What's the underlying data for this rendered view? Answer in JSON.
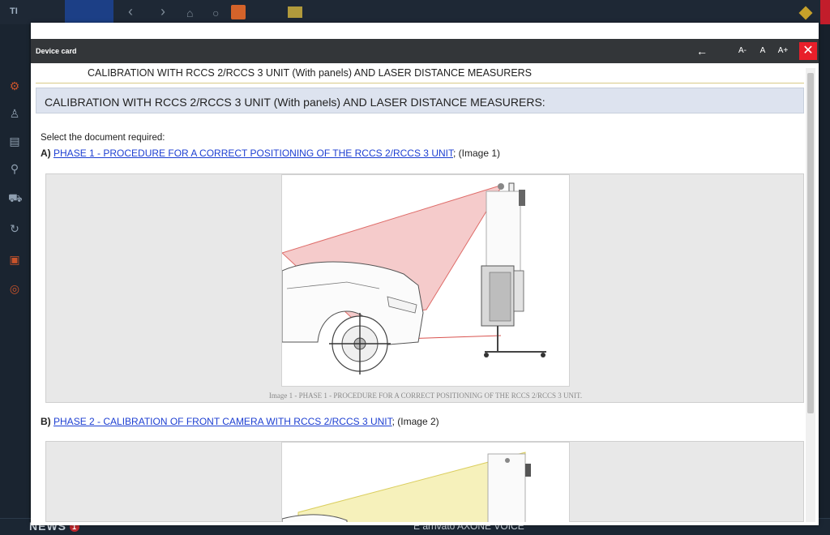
{
  "app": {
    "logo": "TI",
    "news_label": "NEWS",
    "news_count": "1",
    "ticker": "È arrivato AXONE VOICE"
  },
  "dialog": {
    "title": "Device card",
    "back_icon": "←",
    "font_smaller": "A-",
    "font_normal": "A",
    "font_larger": "A+",
    "close_icon": "✕"
  },
  "content": {
    "subtitle": "CALIBRATION WITH RCCS 2/RCCS 3 UNIT (With panels) AND LASER DISTANCE MEASURERS",
    "section_heading": "CALIBRATION WITH RCCS 2/RCCS 3 UNIT (With panels) AND LASER DISTANCE MEASURERS:",
    "select_prompt": "Select the document required:",
    "items": [
      {
        "prefix": "A)",
        "link": "PHASE 1 - PROCEDURE FOR A CORRECT POSITIONING OF THE RCCS 2/RCCS 3 UNIT",
        "suffix": "; (Image 1)",
        "caption": "Image 1 - PHASE 1 - PROCEDURE FOR A CORRECT POSITIONING OF THE RCCS 2/RCCS 3 UNIT."
      },
      {
        "prefix": "B)",
        "link": "PHASE 2 - CALIBRATION OF FRONT CAMERA WITH RCCS 2/RCCS 3 UNIT",
        "suffix": "; (Image 2)"
      }
    ]
  },
  "colors": {
    "laser_red": "#e07a7a",
    "laser_yellow": "#efe58b",
    "link_blue": "#1d3fd2",
    "header_dark": "#333639",
    "close_red": "#e81f2a"
  }
}
